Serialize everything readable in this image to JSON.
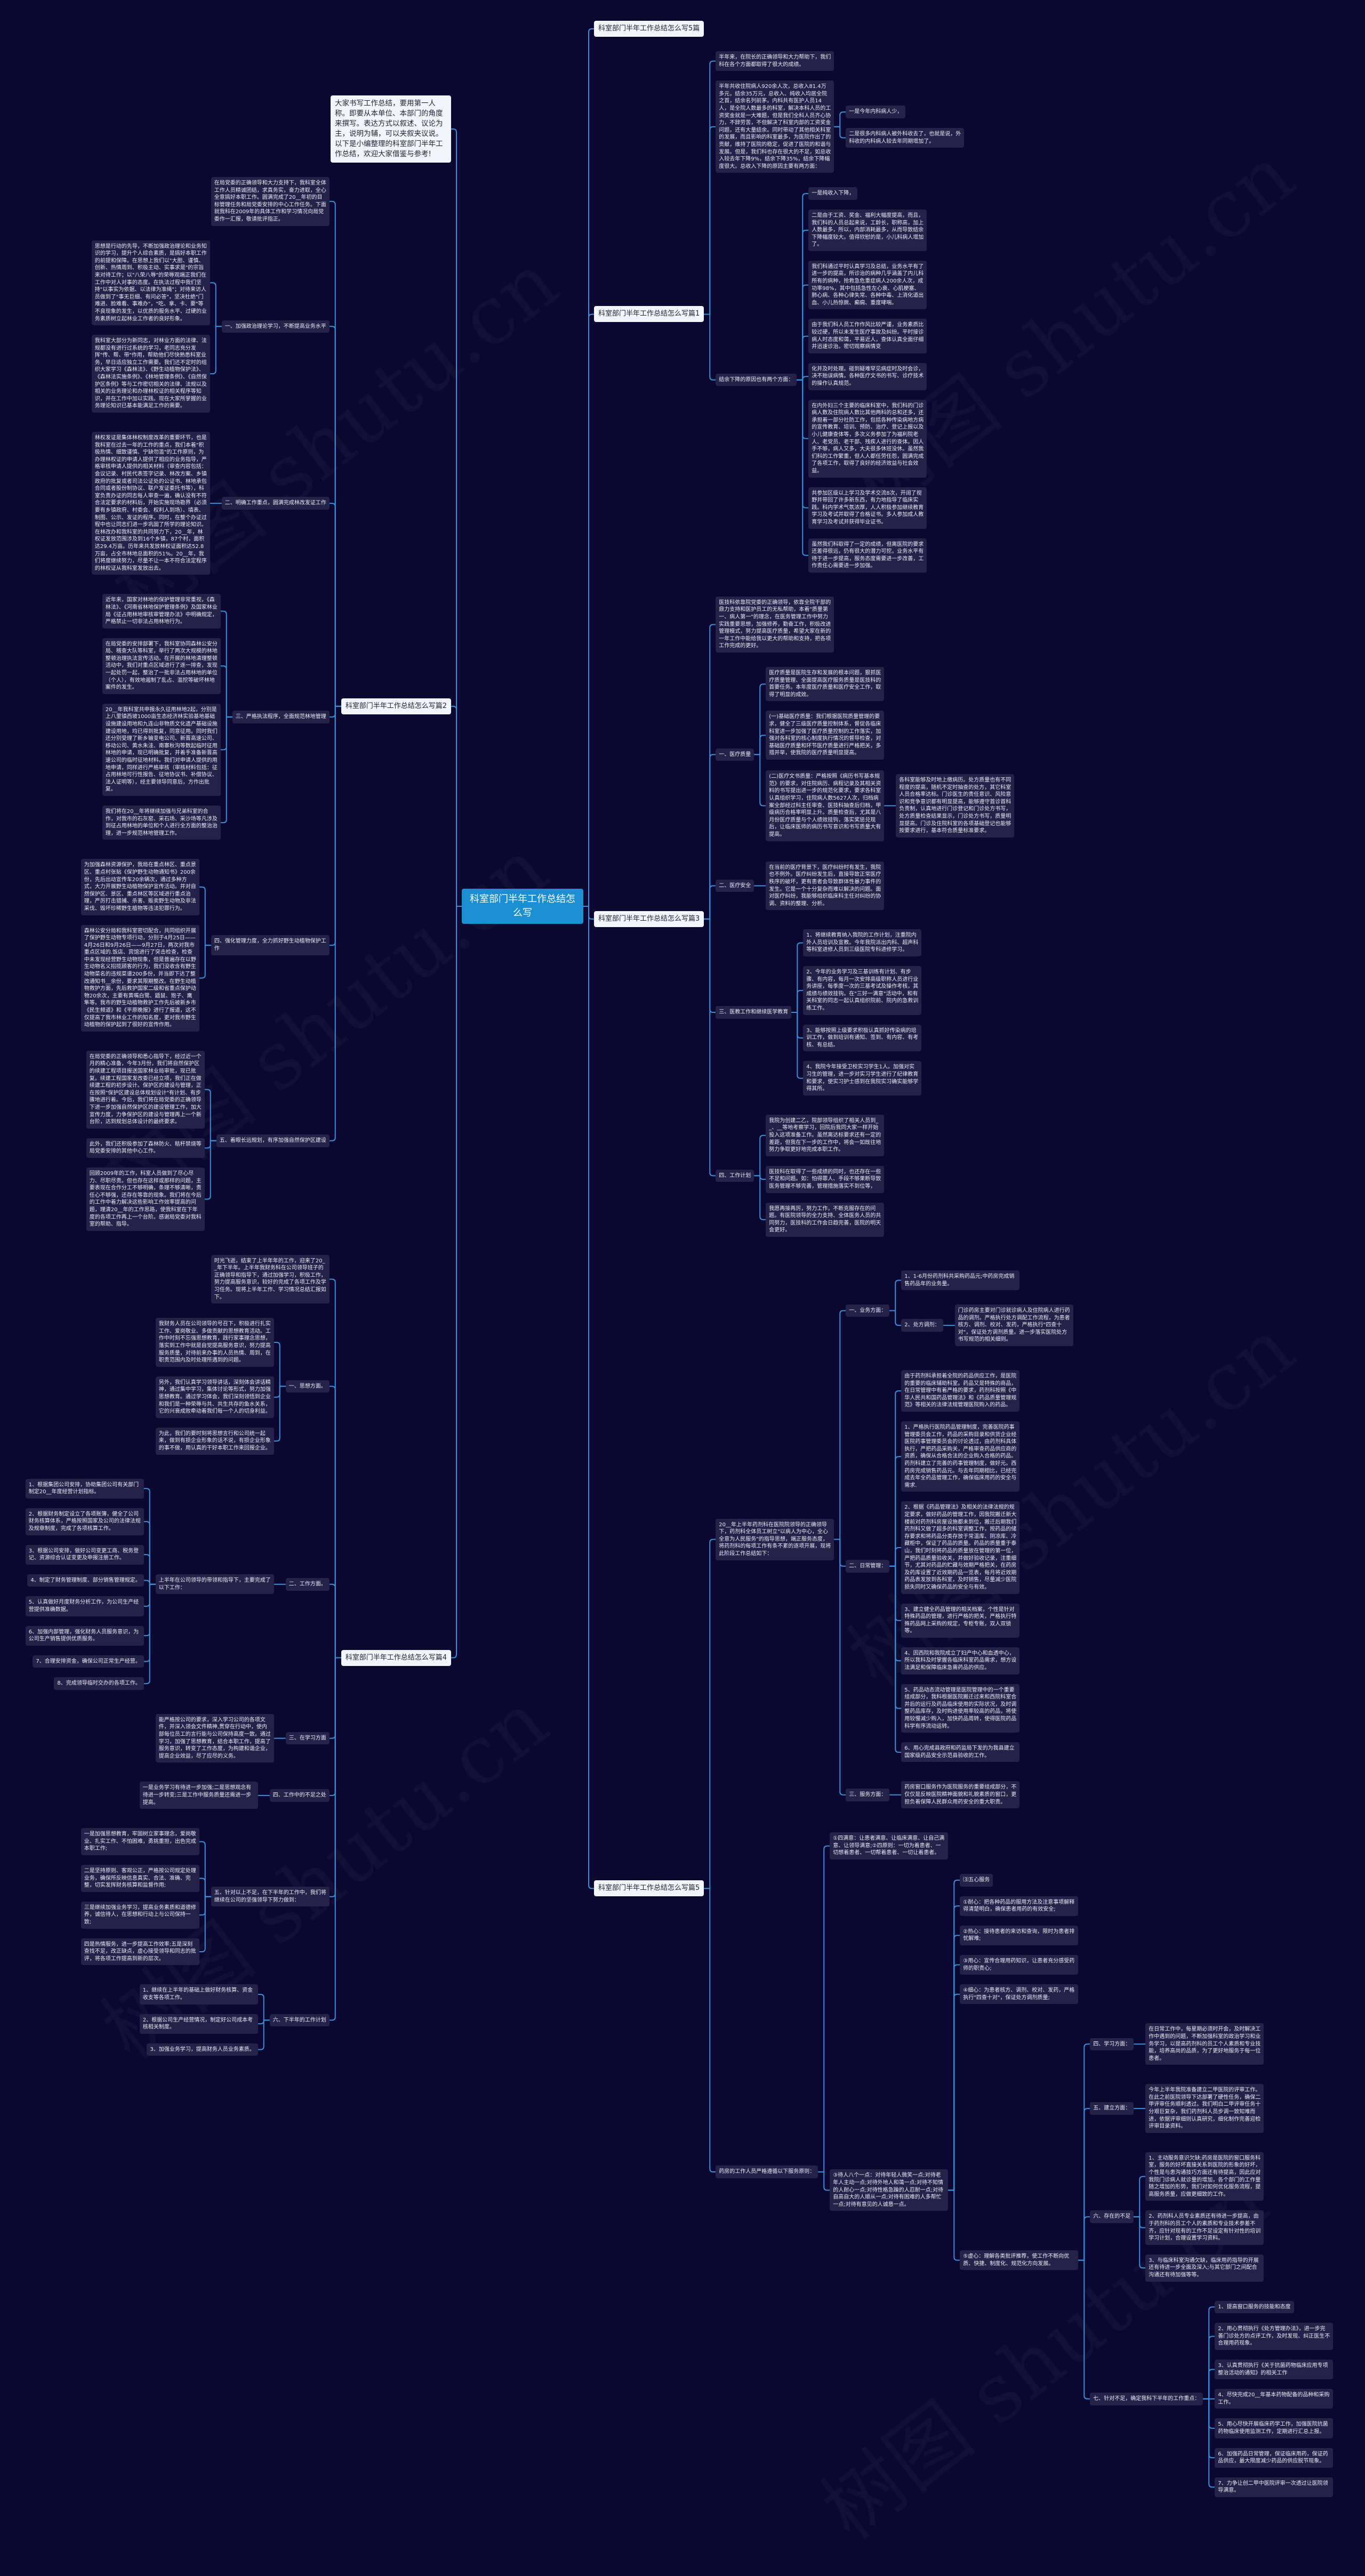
{
  "watermark": "树图 shutu.cn",
  "colors": {
    "background": "#0a0730",
    "root": "#1b8fd2",
    "node": "#25224a",
    "title_node": "#f2f5fb",
    "connector": "#3a8fd8"
  },
  "root": {
    "title": "科室部门半年工作总结怎么写"
  },
  "right": [
    {
      "text": "科室部门半年工作总结怎么写5篇"
    },
    {
      "text": "科室部门半年工作总结怎么写篇1",
      "children": [
        {
          "text": "半年来，在院长的正确领导和大力帮助下，我们科在各个方面都取得了很大的成绩。"
        },
        {
          "text": "半年共收住院病人920余人次，总收入81.4万多元，结余35万元，总收入、纯收入均居全院之首，结余名列前茅。内科共有医护人员14人，是全院人数最多的科室，解决本科人员的工资奖金就是一大难题，但是我们全科人员齐心协力，不辞劳苦，不但解决了科室内部的工资奖金问题，还有大量结余。同时带动了其他相关科室的发展，而且影响的科室最多，为医院作出了的贡献，维持了医院的稳定，促进了医院的和谐与发展。但是，我们科也存在很大的不足，如总收入较去年下降9%，结余下降35%，结余下降幅度很大。总收入下降的原因主要有两方面：",
          "children": [
            {
              "text": "一是今年内科病人少，"
            },
            {
              "text": "二是很多内科病人被外科收去了，也就是说，外科收的内科病人较去年同期增加了。"
            }
          ]
        },
        {
          "text": "结余下降的原因也有两个方面：",
          "children": [
            {
              "text": "一是纯收入下降，"
            },
            {
              "text": "二是由于工资、奖金、福利大幅度提高，而且，我们科的人员总起来说，工龄长，职称高，加上人数最多，所以，内部消耗最多，从而导致结余下降幅度较大。值得欣慰的是，小儿科病人增加了。"
            },
            {
              "text": "我们科通过平时认真学习及总结，业务水平有了进一步的提高，所诊治的病种几乎涵盖了内儿科所有的病种，抢救急危重症病人200余人次，成功率98%，其中包括急性左心衰、心肌梗塞、肺心病、各种心律失常、各种中毒、上消化道出血、小儿热惊厥、癫痫、重度哮喘。"
            },
            {
              "text": "由于我们科人员工作作风比较严谨，业务素质比较过硬，所以未发生医疗事故及纠纷。平时接诊病人时态度和蔼，平易近人，查体认真全面仔细并迅速诊治。密切观察病情变"
            },
            {
              "text": "化并及时处理。碰到疑难罕见病症时及时会诊，决不贻误病情。各种医疗文书的书写、诊疗技术的操作认真规范。"
            },
            {
              "text": "在内外妇三个主要的临床科室中，我们科的门诊病人数及住院病人数比其他两科的总和还多，还承担着一部分社防工作，包括各种传染病地方病的宣传教育、培训、预防、治疗、登记上报以及小儿健康查体等，多次义务参加了为福利院老人、老党员、老干部、残疾人进行的查体。因人手不够，病人又多，大夫很多休班没休。虽然我们科的工作繁重，但人人都任劳任怨，圆满完成了各项工作，取得了良好的经济效益与社会效益。"
            },
            {
              "text": "共参加区级以上学习及学术交流8次，开阔了视野并带回了许多新东西，有力地指导了临床实践。科内学术气氛浓厚，人人积极参加继续教育学习及考试并取得了合格证书。多人参加成人教育学习及考试并获得毕业证书。"
            },
            {
              "text": "虽然我们科取得了一定的成绩，但离医院的要求还差得很远，仍有很大的潜力可挖，业务水平有待于进一步提高，服务态度需要进一步改善，工作责任心需要进一步加强。"
            }
          ]
        }
      ]
    },
    {
      "text": "科室部门半年工作总结怎么写篇3",
      "children": [
        {
          "text": "医技科依靠院党委的正确领导，依靠全院干部的鼎力支持和医护员工的无私帮助，本着\"质量第一、病人第一\"的理念，在医务管理工作中努力实践重要思想，加强修养，勤奋工作，积极改进管理模式，努力提高医疗质量，希望大家在新的一年工作中能给我以更大的帮助和支持，把各项工作完成的更好。"
        },
        {
          "text": "一、医疗质量",
          "children": [
            {
              "text": "医疗质量是医院生存和发展的根本问题，狠抓医疗质量管理、全面提高医疗服务质量是医技科的首要任务。本年度医疗质量和医疗安全工作，取得了明显的成效。"
            },
            {
              "text": "(一)基础医疗质量：我们根据医院质量管理的要求，健全了三级医疗质量控制体系，督促各临床科室进一步加强了医疗质量控制的工作落实，加强对各科室的核心制度执行情况的督导检查，对基础医疗质量和环节医疗质量进行严格把关，多措并举，使我院的医疗质量明显提高。"
            },
            {
              "text": "(二)医疗文书质量：严格按照《病历书写基本规范》的要求，对住院病历、病程记录及其相关资料的书写提出进一步的规范化要求，要求各科室认真组织学习，住院病人数5627人次，归档病案全部经过科主任审查、医技科抽查后归档，甲级病历合格率明显上升。质量检查后，尤其是八月份医疗质量与个人绩效挂钩，落实奖惩兑现后，让临床医师的病历书写意识和书写质量大有提高。",
              "children": [
                {
                  "text": "各科室能够及时地上缴病历。处方质量也有不同程度的提高，随机不定时抽查的处方，其它科室人员合格率达标。门诊医生的责任意识、风险意识和竞争意识都有明显提高，能够遵守首诊首科负责制，认真地进行门诊登记和门诊处方书写，处方质量检查结果显示，门诊处方书写，质量明显提高。门诊及住院科室的各项基础登记也能够按要求进行，基本符合质量标准要求。"
                }
              ]
            }
          ]
        },
        {
          "text": "二、医疗安全",
          "children": [
            {
              "text": "在当前的医疗背景下，医疗纠纷时有发生，我院也不例外。医疗纠纷发生后，直接导致正常医疗秩序的破坏，更有患者会导致群体性暴力事件的发生。它是一个十分复杂而难以解决的问题。面对医疗纠纷，我能够组织临床科主任对纠纷的协调、资料的整理、分析。"
            }
          ]
        },
        {
          "text": "三、医教工作和继续医学教育",
          "children": [
            {
              "text": "1、将继续教育纳入我院的工作计划，注重院内外人员培训及宣教。今年我院派出内科、超声科等科室进修人员到三级医院专科进修学习。"
            },
            {
              "text": "2、今年的业务学习及三基训练有计划、有步骤、有内容，每月一次安排高级职称人员进行业务讲座，每季度一次的三基考试及操作考核，其成绩与绩效挂钩。在\"三好一满意\"活动中，和有关科室的同志一起认真组织院前、院内的急救训练工作。"
            },
            {
              "text": "3、能够按照上级要求积极认真抓好传染病的培训工作，做到培训有通知、签到、有内容、有考核、有总结。"
            },
            {
              "text": "4、我院今年接受卫校实习学生1人。加强对实习生的管理，进一步对实习学生进行了纪律教育和要求，使实习护士感到在我院实习确实能够学得其所。"
            }
          ]
        },
        {
          "text": "四、工作计划",
          "children": [
            {
              "text": "我院为创建二乙，院部领导组织了相关人员到__、__等地考察学习，回院后我同大家一样开始投入这项准备工作。虽然离达标要求还有一定的差距，但我在下一步的工作中，将会一如既往地努力争取更好地完成本职工作。"
            },
            {
              "text": "医技科在取得了一些成绩的同时，也还存在一些不足和问题。如：怕得罪人、手段不够果断导致医务管理不够完善，管理措施落实不到位等，"
            },
            {
              "text": "我愿再接再厉，努力工作，不断克服存在的问题。有医院领导的全力支持、全体医务人员的共同努力，医技科的工作会日趋完善，医院的明天会更好。"
            }
          ]
        }
      ]
    },
    {
      "text": "科室部门半年工作总结怎么写篇5",
      "children": [
        {
          "text": "20__年上半年药剂科在医院院领导的正确领导下，药剂科全体员工树立\"以病人为中心，全心全意为人民服务\"的指导思想，端正服务态度，将药剂科的每项工作有条不紊的逐项开展，现将此阶段工作总结如下：",
          "children": [
            {
              "text": "一、业务方面：",
              "children": [
                {
                  "text": "1、1-6月份药剂科共采购药品元;中药房完成销售药品年的业务量。"
                },
                {
                  "text": "2、处方调剂：",
                  "children": [
                    {
                      "text": "门诊药房主要对门诊就诊病人及住院病人进行药品的调剂。严格执行处方调配工作流程，为患者核方、调剂、校对、发药，严格执行\"四查十对\"，保证处方调剂质量。进一步落实医院处方书写规范的相关细则。"
                    }
                  ]
                }
              ]
            },
            {
              "text": "二、日常管理：",
              "children": [
                {
                  "text": "由于药剂科承担着全院的药品供应工作，是医院的重要的临床辅助科室。药品又是特殊的商品，在日常管理中有着严格的要求，药剂科按照《中华人民共和国药品管理法》和《药品质量管理规范》等相关的法律法规管理医院购入的药品。"
                },
                {
                  "text": "1、严格执行医院药品管理制度，完善医院药事管理委员会工作，药品的采购目录和供货企业经医院药事管理委员会的讨论透过，由药剂科具体执行，严把药品采购关，严格审查药品供应商的资质，确保从合格合法的企业购入合格的药品。药剂科建立了完善的药事管理制度，做好元。西药房完成销售药品元。与去年同期相比，已经完成去年全药品管理工作，确保临床用药的安全与需求."
                },
                {
                  "text": "2、根据《药品管理法》及相关的法律法规的规定要求，做好药品的管理工作，因我院搬迁新大楼前对药剂科房屋设施都未到位，搬迁后期我们药剂科又做了超多的科室调整工作，按药品的储存要求和将药品分类存放于常温库、阴凉库、冷藏柜中，保证了药品的质量。药品的质量重于泰山，我们时刻将药品的质量放在管理的第一位，严把药品质量验收关，并做好验收记录，注重细节，尤其对药品的贮藏与效期严格把关，在药房及药库设置了近效期药品一览表，每月将近效期药品表发放到各科室，及时销售，尽量减少医院损失同时又确保药品的安全与有效。"
                },
                {
                  "text": "3、建立健全药品管理的相关档案，个性是针对特殊药品的管理，进行严格的把关，严格执行特殊药品网上采购的规定，专柜专账，双人双锁等。"
                },
                {
                  "text": "4、因西院和我院成立了妇产中心和血透中心，所以我科及时掌握各临床科室药品需求，想方设法满足和保障临床急需药品的供应。"
                },
                {
                  "text": "5、药品动态流动管理是医院管理中的一个重要组成部分，我科根据医院搬迁过来和西院科室合并后的运行及药品临床使用的实际状况，及时调整药品库存，及时购进使用率较高的药品，将使用较慢减少购入，加快药品周转，使得医院药品科学有序流动运转。"
                },
                {
                  "text": "6、用心完成县政府和药监局下发的为我县建立国家级药品安全示范县验收的工作。"
                }
              ]
            },
            {
              "text": "三、服务方面：",
              "children": [
                {
                  "text": "药房窗口服务作为医院服务的重要组成部分，不仅仅是反映医院精神面貌和礼貌素质的窗口，更担负着保障人民群众用药安全的重大职责。"
                }
              ]
            }
          ]
        },
        {
          "text": "药房的工作人员严格遵循以下服务原则：",
          "children": [
            {
              "text": "①四满意：让患者满意、让临床满意、让自己满意、让领导满意;②四原则：一切为着患者、一切想着患者、一切帮着患者、一切让着患者。"
            },
            {
              "text": "③待人八个一点：对待年轻人微笑一点;对待老年人主动一点;对待外地人和蔼一点;对待不知情的人耐心一点;对待性格急躁的人忍耐一点;对待自高自大的人顺从一点;对待有困难的人多帮忙一点;对待有意见的人诚恳一点。",
              "children": [
                {
                  "text": "⑶五心服务"
                },
                {
                  "text": "①耐心：把各种药品的服用方法及注意事项解释得清楚明白，确保患者用药的有效安全;"
                },
                {
                  "text": "②热心：接待患者的来访和查询，限时为患者排忧解难;"
                },
                {
                  "text": "③用心：宣传合理用药知识，让患者充分感受药师的职责心;"
                },
                {
                  "text": "④细心：为患者核方、调剂、校对、发药，严格执行\"四查十对\"，保证处方调剂质量;"
                },
                {
                  "text": "⑤虚心：理解各类批评推荐，使工作不断向优质、快捷、制度化、规范化方向发展。",
                  "children": [
                    {
                      "text": "四、学习方面：",
                      "children": [
                        {
                          "text": "在日常工作中，每星期必须时开会，及时解决工作中遇到的问题，不断加强科室的政治学习和业务学习，以提高药剂科的员工个人素质和专业技能，培养高尚的品质，为了更好地服务于每一位患者。"
                        }
                      ]
                    },
                    {
                      "text": "五、建立方面：",
                      "children": [
                        {
                          "text": "今年上半年我院准备建立二甲医院的评审工作。在此之前医院领导下达部署了硬性任务，确保二甲评审任务顺利透过。我们明白二甲评审任务十分艰巨复杂，我们药剂科人员步调一致知难而进，依据评审细则认真研究，细化制作完善迎检评审目录资料。"
                        }
                      ]
                    },
                    {
                      "text": "六、存在的不足",
                      "children": [
                        {
                          "text": "1、主动服务意识欠缺;药房是医院的窗口服务科室，服务的好坏直接关系到医院的形象的好坏，个性是与患沟通技巧方面还有待提高，因此应对我院门诊病人就诊量的增加，各个部门的工作量随之增加的形势，我们对如何优化服务流程，提高服务质量，应做更细致的工作。"
                        },
                        {
                          "text": "2、药剂科人员专业素质还有待进一步提高，由于药剂科的员工个人的素质和专业技术参差不齐，应针对现有的工作不足设定有针对性的培训学习计划，合理设置学习资料。"
                        },
                        {
                          "text": "3、与临床科室沟通欠缺，临床用药指导的开展还有待进一步全面及深入;与其它部门之间配合沟通还有待加强等等。"
                        }
                      ]
                    },
                    {
                      "text": "七、针对不足，确定我科下半年的工作重点：",
                      "children": [
                        {
                          "text": "1、提高窗口服务的技能和态度"
                        },
                        {
                          "text": "2、用心贯彻执行《处方管理办法》，进一步完善门诊处方的点评工作，及时发现、纠正医生不合理用药现象。"
                        },
                        {
                          "text": "3、认真贯彻执行《关于抗菌药物临床应用专项整治活动的通知》的相关工作"
                        },
                        {
                          "text": "4、尽快完成20__年基本药物配备的品种和采购工作。"
                        },
                        {
                          "text": "5、用心尽快开展临床药学工作，加强医院抗菌药物临床使用监测工作，定期进行汇总上报。"
                        },
                        {
                          "text": "6、加强药品日常管理，保证临床用药，保证药品供应，最大限度减少药品的供应脱节现象。"
                        },
                        {
                          "text": "7、力争让创二甲中医院评审一次透过让医院领导满意。"
                        }
                      ]
                    }
                  ]
                }
              ]
            }
          ]
        }
      ]
    }
  ],
  "left": [
    {
      "text": "大家书写工作总结，要用第一人称。即要从本单位、本部门的角度来撰写。表达方式以叙述、议论为主，说明为辅，可以夹叙夹议说。以下是小编整理的科室部门半年工作总结，欢迎大家借鉴与参考!",
      "intro": true
    },
    {
      "text": "科室部门半年工作总结怎么写篇2",
      "children": [
        {
          "text": "在局党委的正确领导和大力支持下，我科室全体工作人员精诚团结，求真务实，奋力进取，全心全意搞好本职工作。圆满完成了20__年初的目标管理任务和局党委安排的中心工作任务。下面就我科在2009年的具体工作和学习情况向局党委作一汇报，敬请批评指正。"
        },
        {
          "text": "一、加强政治理论学习，不断提高业务水平",
          "children": [
            {
              "text": "思想是行动的先导，不断加强政治理论和业务知识的学习，提升个人综合素质，是搞好本职工作的前提和保障。在思想上我们以\"大胆、谨慎、创新、热情周到、积极主动、实事求是\"的宗旨来对待工作；以\"八荣八辱\"的荣辱观端正我们在工作中对人对事的态度。在执法过程中我们坚持\"以事实为依据、以法律为准绳\"；对待来访人员做到了\"事无巨细、有问必答\"，坚决杜绝\"门难进、脸难看、事难办\"，\"吃、拿、卡、要\"等不良现象的发生，以优质的服务水平、过硬的业务素质树立起林业工作者的良好形象。"
            },
            {
              "text": "我科室大部分为新同志，对林业方面的法律、法规都没有进行过系统的学习，老同志充分发挥\"传、帮、带\"作用，帮助他们尽快熟悉科室业务，早日适应独立工作需要。我们还不定时的组织大家学习《森林法》、《野生动植物保护法》、《森林法实施条例》、《林地管理条例》、《自然保护区条例》等与工作密切相关的法律、法规以及相关的业务理论和办理林权证的相关程序等知识，并在工作中加以实践。现在大家所掌握的业务理论知识已基本能满足工作的需要。"
            }
          ]
        },
        {
          "text": "二、明确工作重点，圆满完成林改发证工作",
          "children": [
            {
              "text": "林权发证是集体林权制度改革的重要环节，也是我科室在过去一年的工作的重点，我们本着\"积极热情、细致谨慎、宁缺勿滥\"的工作原则，为办理林权证的申请人提供了相应的业务指导，严格审核申请人提供的相关材料（审查内容包括：会议记录、村民代表签字记录、林改方案、乡镇政府的批复或者司法公证处的公证书、林地承包合同或者股份制协议、联户发证委托书等），科室负责办证的同志每人审查一遍，确认没有不符合法定要求的材料后，开始实施现场勘界（必须要有乡镇政府、村委会、权利人到场）、填表、制图、公示、发证的程序。同时，在整个办证过程中也让同志们进一步巩固了所学的理论知识。在林改办和我科室的共同努力下，20__年，林权证发放范围涉及到16个乡镇，87个村，面积达29.4万亩。历年来共发放林权证面积达52.8万亩，占全市林地总面积的51%。20__年，我们将度继续努力，尽量不让一本不符合法定程序的林权证从我科室发放出去。"
            }
          ]
        },
        {
          "text": "三、严格执法程序，全面规范林地管理",
          "children": [
            {
              "text": "近年来，国家对林地的保护管理非常重视，《森林法》、《河南省林地保护管理条例》及国家林业局《征占用林地审核审管理办法》中明确规定，严格禁止一切非法占用林地行为。"
            },
            {
              "text": "在局党委的安排部署下，我科室协同森林公安分局、稽查大队等科室，举行了两次大规模的林地整顿治理执法宣传活动。在开展的林地清理整顿活动中，我们对重点区域进行了逐一排查，发现一起处罚一起，整治了一批非法占用林地的单位（个人），有效地遏制了乱占、滥挖等破坏林地案件的发生。"
            },
            {
              "text": "20__年我科室共申报永久征用林地2起，分别是上八里镇西坡1000亩生态经济林实验基地基础设施建设用地和九连山非物质文化遗产基础设施建设用地，均已得到批复，同意征用。同时我们还分别受理了新乡输变电公司、新晋高速公司、移动公司、黄水朱洼、南寨秋沟等数起临时征用林地的申请，现已明确批复，并着手准备新晋高速公司的临时征地材料。我们对申请人提供的用地申请，同样进行严格审核（审核材料包括：征占用林地可行性报告、征地协议书、补偿协议、法人证明等），经主要领导同意后，方作出批复。"
            },
            {
              "text": "我们将在20__年将继续加强与兄弟科室的合作，对我市的石灰窑、采石场、采沙场等凡涉及到征占用林地的单位和个人进行全方面的整治治理，进一步规范林地管理工作。"
            }
          ]
        },
        {
          "text": "四、强化管理力度，全力抓好野生动植物保护工作",
          "children": [
            {
              "text": "为加强森林资源保护，我局在重点林区、重点景区、重点村张贴《保护野生动物通知书》200余份，先后出动宣传车20余辆次，通过多种方式，大力开展野生动植物保护宣传活动。并对自然保护区、景区、重点林区等区域进行重点治理，严厉打击猎捕、杀害、贩卖野生动物及非法采伐、毁坏珍稀野生植物等违法犯罪行为。"
            },
            {
              "text": "森林公安分局和我科室密切配合，共同组织开展了保护野生动物专项行动，分别于4月25日——4月26日和9月26日——9月27日，两次对我市重点区域的.饭店、宾馆进行了突击检查，检查中未发现经营野生动物现象，但是普遍存在以野生动物名义招揽顾客的行为，我们没收含有野生动物菜名的违规菜谱200多份，并当即下达了整改通知书__余份，要求其限期整改。在野生动植物救护方面，先后救护国家二级和省重点保护动物20余次，主要有黄嘴白鹭、鼯鼠、狍子、鹰隼等。我市的野生动植物救护工作先后被新乡市《民生频道》和《平原晚报》进行了报道，这不仅提高了我市林业工作的知名度，更对我市野生动植物的保护起到了很好的宣传作用。"
            }
          ]
        },
        {
          "text": "五、着眼长远规划，有序加强自然保护区建设",
          "children": [
            {
              "text": "在局党委的正确领导和悉心指导下，经过近一个月的精心准备，今年3月份，我们将自然保护区的续建工程项目报送国家林业局审批，现已批复。续建工程国家发改委已经立项，我们正在做续建工程的初步设计。保护区的建设与管理，正在按照\"保护区建设总体规划设计\"有计划、有步骤地进行着。今后，我们将在局党委的正确领导下进一步加强自然保护区的建设管理工作，加大宣传力度，力争保护区的建设与管理再上一个新台阶，达到规划总体设计的最终要求。"
            },
            {
              "text": "此外，我们还积极参加了森林防火、秸秆禁烧等局党委安排的其他中心工作。"
            },
            {
              "text": "回顾2009年的工作，科室人员做到了尽心尽力、尽职尽责。但也存在这样或那样的问题，主要表现在合作分工不够明确，条理不够清晰，责任心不够强，还存在等靠的现象。我们将在今后的工作中着力解决这些影响工作效率提高的问题，理清20__年的工作思路，使我科室在下年度的各项工作再上一个台阶。感谢局党委对我科室的帮助、指导。"
            }
          ]
        }
      ]
    },
    {
      "text": "科室部门半年工作总结怎么写篇4",
      "children": [
        {
          "text": "时光飞逝，结束了上半年年的工作，迎来了20__年下半年。上半年我财务科在公司领导班子的正确领导和指导下，通过加强学习，积极工作，努力提高服务意识，较好的完成了各项工作及学习任务。现将上半年工作、学习情况总结汇报如下。"
        },
        {
          "text": "一、思想方面。",
          "children": [
            {
              "text": "我财务人员在公司领导的号召下，积极进行扎实工作、爱岗敬业、多做贡献的思想教育活动。工作中时刻不忘强思想教育，践行家事理念思想，落实到工作中就是自觉提高服务意识，努力提高服务质量，对待前来办事的人员热情、周到，在职责范围内及时处理所遇到的问题。"
            },
            {
              "text": "另外，我们认真学习领导讲话，深刻体会讲话精神，通过集中学习，集体讨论等形式，努力加强思想教育。通过学习体会，我们深刻领悟到企业和我们是一种荣辱与共、共生共存的鱼水关系，它的兴衰成败牵动着我们每一个人的切身利益。"
            },
            {
              "text": "为此，我们的要时刻将思想言行和公司统一起来，做到有损企业形象的话不说，有损企业形象的事不做，用认真的干好本职工作来回报企业。"
            }
          ]
        },
        {
          "text": "二、工作方面。",
          "children": [
            {
              "text": "上半年在公司领导的带领和指导下，主要完成了以下工作：",
              "children": [
                {
                  "text": "1、根据集团公司安排，协助集团公司有关部门制定20__年度经营计划指标。"
                },
                {
                  "text": "2、根据财务制定设立了各项账簿，健全了公司财务核算体系，严格按照国家及公司的法律法规及规章制度，完成了各项核算工作。"
                },
                {
                  "text": "3、根据公司安排，做好公司变更工商、税务登记、资源综合认证变更及申报注册工作。"
                },
                {
                  "text": "4、制定了财务管理制度、部分销售管理规定。"
                },
                {
                  "text": "5、认真做好月度财务分析工作，为公司生产经营提供准确数据。"
                },
                {
                  "text": "6、加强内部管理，强化财务人员服务意识，为公司生产销售提供优质服务。"
                },
                {
                  "text": "7、合理安排资金，确保公司正常生产经营。"
                },
                {
                  "text": "8、完成领导临时交办的各项工作。"
                }
              ]
            }
          ]
        },
        {
          "text": "三、在学习方面",
          "children": [
            {
              "text": "能严格按公司的要求，深入学习公司的各项文件，并深入领会文件精神,贯穿在行动中，使内部每位员工的言行能与公司保持高度一致。通过学习，加强了思想教育，结合本职工作，提高了服务意识，转变了工作态度，为构建和谐企业，提高企业效益，尽了应尽的义务。"
            }
          ]
        },
        {
          "text": "四、工作中的不足之处",
          "children": [
            {
              "text": "一是业务学习有待进一步加强;二是思想观念有待进一步转变;三是工作中服务质量还需进一步提高。"
            }
          ]
        },
        {
          "text": "五、针对以上不足，在下半年的工作中，我们将继续在公司的坚强领导下努力做到：",
          "children": [
            {
              "text": "一是加强思想教育，牢固树立家事理念，爱岗敬业、扎实工作、不怕困难，勇挑重担，出色完成本职工作;"
            },
            {
              "text": "二是坚持原则、客观公正，严格按公司规定处理业务，确保所反映信息真实、合法、准确、完整，切实发挥财务核算和监督作用;"
            },
            {
              "text": "三是继续加强业务学习，提高业务素质和道德修养，诚信待人，在思想和行动上与公司保持一致;"
            },
            {
              "text": "四是热情服务，进一步提高工作效率;五是深刻查找不足，改正缺点，虚心接受领导和同志的批评，将各项工作提高到新的层次。"
            }
          ]
        },
        {
          "text": "六、下半年的工作计划",
          "children": [
            {
              "text": "1、继续在上半年的基础上做好财务核算、资金收支等各项工作。"
            },
            {
              "text": "2、根据公司生产经营情况，制定好公司成本考核相关制度。"
            },
            {
              "text": "3、加强业务学习，提高财务人员业务素质。"
            }
          ]
        }
      ]
    }
  ]
}
